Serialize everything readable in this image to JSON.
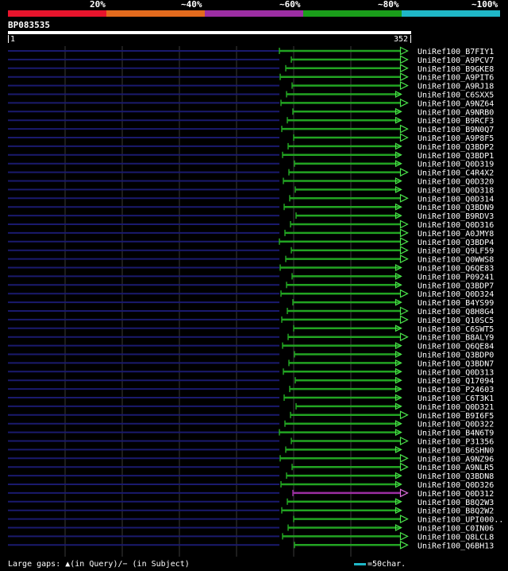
{
  "header": {
    "percent_labels": [
      "20%",
      "~40%",
      "~60%",
      "~80%",
      "~100%"
    ],
    "segment_colors": [
      "#e8142c",
      "#e36a1d",
      "#9c2ea3",
      "#1a9e1a",
      "#1fb7c7"
    ]
  },
  "query": {
    "name": "BP083535",
    "start": "1",
    "end": "352"
  },
  "colors": {
    "hit_green": "#22a422",
    "hit_purple": "#9c2ea3",
    "track": "#1a1a6e",
    "arrow_green": "#4ae34a",
    "arrow_pink": "#e070e0"
  },
  "hits": [
    {
      "name": "UniRef100_B7FIY1",
      "c": "g",
      "big": 1
    },
    {
      "name": "UniRef100_A9PCV7",
      "c": "g",
      "big": 1
    },
    {
      "name": "UniRef100_B9GKE8",
      "c": "g",
      "big": 1
    },
    {
      "name": "UniRef100_A9PIT6",
      "c": "g",
      "big": 1
    },
    {
      "name": "UniRef100_A9RJ18",
      "c": "g",
      "big": 1
    },
    {
      "name": "UniRef100_C6SXX5",
      "c": "g",
      "big": 0
    },
    {
      "name": "UniRef100_A9NZ64",
      "c": "g",
      "big": 1
    },
    {
      "name": "UniRef100_A9NRB0",
      "c": "g",
      "big": 0
    },
    {
      "name": "UniRef100_B9RCF3",
      "c": "g",
      "big": 0
    },
    {
      "name": "UniRef100_B9N0Q7",
      "c": "g",
      "big": 1
    },
    {
      "name": "UniRef100_A9P8F5",
      "c": "g",
      "big": 1
    },
    {
      "name": "UniRef100_Q3BDP2",
      "c": "g",
      "big": 0
    },
    {
      "name": "UniRef100_Q3BDP1",
      "c": "g",
      "big": 0
    },
    {
      "name": "UniRef100_Q0D319",
      "c": "g",
      "big": 0
    },
    {
      "name": "UniRef100_C4R4X2",
      "c": "g",
      "big": 1
    },
    {
      "name": "UniRef100_Q0D320",
      "c": "g",
      "big": 0
    },
    {
      "name": "UniRef100_Q0D318",
      "c": "g",
      "big": 0
    },
    {
      "name": "UniRef100_Q0D314",
      "c": "g",
      "big": 1
    },
    {
      "name": "UniRef100_Q3BDN9",
      "c": "g",
      "big": 0
    },
    {
      "name": "UniRef100_B9RDV3",
      "c": "g",
      "big": 0
    },
    {
      "name": "UniRef100_Q0D316",
      "c": "g",
      "big": 1
    },
    {
      "name": "UniRef100_A0JMY8",
      "c": "g",
      "big": 1
    },
    {
      "name": "UniRef100_Q3BDP4",
      "c": "g",
      "big": 1
    },
    {
      "name": "UniRef100_Q9LF59",
      "c": "g",
      "big": 1
    },
    {
      "name": "UniRef100_Q0WWS8",
      "c": "g",
      "big": 1
    },
    {
      "name": "UniRef100_Q6QE83",
      "c": "g",
      "big": 0
    },
    {
      "name": "UniRef100_P09241",
      "c": "g",
      "big": 0
    },
    {
      "name": "UniRef100_Q3BDP7",
      "c": "g",
      "big": 0
    },
    {
      "name": "UniRef100_Q0D324",
      "c": "g",
      "big": 1
    },
    {
      "name": "UniRef100_B4YS99",
      "c": "g",
      "big": 0
    },
    {
      "name": "UniRef100_Q8H8G4",
      "c": "g",
      "big": 1
    },
    {
      "name": "UniRef100_Q10SC5",
      "c": "g",
      "big": 1
    },
    {
      "name": "UniRef100_C6SWT5",
      "c": "g",
      "big": 0
    },
    {
      "name": "UniRef100_B8ALY9",
      "c": "g",
      "big": 1
    },
    {
      "name": "UniRef100_Q6QE84",
      "c": "g",
      "big": 0
    },
    {
      "name": "UniRef100_Q3BDP0",
      "c": "g",
      "big": 0
    },
    {
      "name": "UniRef100_Q3BDN7",
      "c": "g",
      "big": 0
    },
    {
      "name": "UniRef100_Q0D313",
      "c": "g",
      "big": 0
    },
    {
      "name": "UniRef100_Q17094",
      "c": "g",
      "big": 0
    },
    {
      "name": "UniRef100_P24603",
      "c": "g",
      "big": 0
    },
    {
      "name": "UniRef100_C6T3K1",
      "c": "g",
      "big": 0
    },
    {
      "name": "UniRef100_Q0D321",
      "c": "g",
      "big": 0
    },
    {
      "name": "UniRef100_B9I6F5",
      "c": "g",
      "big": 1
    },
    {
      "name": "UniRef100_Q0D322",
      "c": "g",
      "big": 0
    },
    {
      "name": "UniRef100_B4N6T9",
      "c": "g",
      "big": 0
    },
    {
      "name": "UniRef100_P31356",
      "c": "g",
      "big": 1
    },
    {
      "name": "UniRef100_B6SHN0",
      "c": "g",
      "big": 0
    },
    {
      "name": "UniRef100_A9NZ96",
      "c": "g",
      "big": 1
    },
    {
      "name": "UniRef100_A9NLR5",
      "c": "g",
      "big": 1
    },
    {
      "name": "UniRef100_Q3BDN8",
      "c": "g",
      "big": 0
    },
    {
      "name": "UniRef100_Q0D326",
      "c": "g",
      "big": 0
    },
    {
      "name": "UniRef100_Q0D312",
      "c": "p",
      "big": 1
    },
    {
      "name": "UniRef100_B8Q2W3",
      "c": "g",
      "big": 0
    },
    {
      "name": "UniRef100_B8Q2W2",
      "c": "g",
      "big": 0
    },
    {
      "name": "UniRef100_UPI000..",
      "c": "g",
      "big": 1
    },
    {
      "name": "UniRef100_C0IN06",
      "c": "g",
      "big": 0
    },
    {
      "name": "UniRef100_Q8LCL8",
      "c": "g",
      "big": 1
    },
    {
      "name": "UniRef100_Q6BH13",
      "c": "g",
      "big": 1
    }
  ],
  "legend": {
    "text": "Large gaps: ▲(in Query)/− (in Subject)",
    "scale": "=50char."
  }
}
